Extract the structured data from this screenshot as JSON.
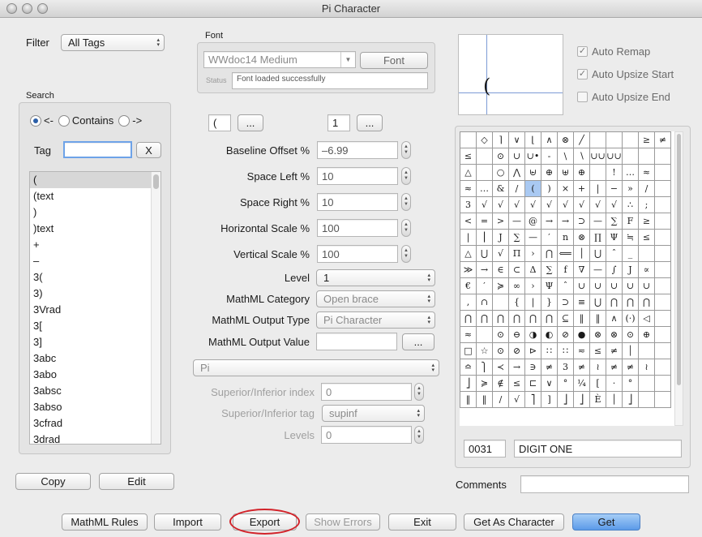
{
  "window": {
    "title": "Pi Character"
  },
  "filter": {
    "label": "Filter",
    "value": "All Tags"
  },
  "search": {
    "label": "Search",
    "dir_left": "<-",
    "contains": "Contains",
    "dir_right": "->",
    "tag_label": "Tag",
    "tag_value": "",
    "clear_label": "X",
    "items": [
      "(",
      "(text",
      ")",
      ")text",
      "+",
      "–",
      "3(",
      "3)",
      "3Vrad",
      "3[",
      "3]",
      "3abc",
      "3abo",
      "3absc",
      "3abso",
      "3cfrad",
      "3drad"
    ],
    "selected_index": 0
  },
  "left_buttons": {
    "copy": "Copy",
    "edit": "Edit"
  },
  "font": {
    "label": "Font",
    "name": "WWdoc14 Medium",
    "button": "Font",
    "status_label": "Status",
    "status_text": "Font loaded successfully"
  },
  "char_row": {
    "char_value": "(",
    "more1": "...",
    "count_value": "1",
    "more2": "..."
  },
  "params": {
    "baseline_label": "Baseline Offset %",
    "baseline_value": "–6.99",
    "space_left_label": "Space Left %",
    "space_left_value": "10",
    "space_right_label": "Space Right %",
    "space_right_value": "10",
    "hscale_label": "Horizontal Scale %",
    "hscale_value": "100",
    "vscale_label": "Vertical Scale %",
    "vscale_value": "100",
    "level_label": "Level",
    "level_value": "1",
    "mml_cat_label": "MathML Category",
    "mml_cat_value": "Open brace",
    "mml_out_type_label": "MathML Output Type",
    "mml_out_type_value": "Pi Character",
    "mml_out_value_label": "MathML Output Value",
    "mml_out_value": "",
    "mml_out_more": "...",
    "pi_value": "Pi",
    "supinf_index_label": "Superior/Inferior index",
    "supinf_index_value": "0",
    "supinf_tag_label": "Superior/Inferior tag",
    "supinf_tag_value": "supinf",
    "levels_label": "Levels",
    "levels_value": "0"
  },
  "preview": {
    "glyph": "("
  },
  "options": {
    "auto_remap": "Auto Remap",
    "auto_remap_checked": true,
    "auto_upsize_start": "Auto Upsize Start",
    "auto_upsize_start_checked": true,
    "auto_upsize_end": "Auto Upsize End",
    "auto_upsize_end_checked": false
  },
  "charmap": {
    "rows": [
      [
        "",
        "◇",
        "⌉",
        "∨",
        "⌊",
        "∧",
        "⊗",
        "╱",
        "",
        "",
        "",
        "≥",
        "≠"
      ],
      [
        "≤",
        "",
        "⊙",
        "∪",
        "∪•",
        "-",
        "\\",
        "∖",
        "∪∪",
        "∪∪",
        "",
        "",
        ""
      ],
      [
        "△",
        "",
        "○",
        "⋀",
        "⊌",
        "⊕",
        "⊎",
        "⊕",
        "",
        "!",
        "…",
        "≈",
        ""
      ],
      [
        "≈",
        "…",
        "&",
        "/",
        "(",
        ")",
        "×",
        "+",
        "|",
        "−",
        "»",
        "/",
        ""
      ],
      [
        "3",
        "√",
        "√",
        "√",
        "√",
        "√",
        "√",
        "√",
        "√",
        "√",
        "∴",
        ";",
        ""
      ],
      [
        "<",
        "=",
        ">",
        "—",
        "@",
        "→",
        "→",
        "⊃",
        "—",
        "∑",
        "F",
        "≥",
        ""
      ],
      [
        "|",
        "⎮",
        "J",
        "∑",
        "—",
        "′",
        "n",
        "⊗",
        "∏",
        "Ψ",
        "≒",
        "≤",
        ""
      ],
      [
        "△",
        "⋃",
        "√",
        "Π",
        "›",
        "⋂",
        "⟸",
        "│",
        "⋃",
        "ˆ",
        "_",
        ""
      ],
      [
        "≫",
        "→",
        "∈",
        "⊂",
        "Δ",
        "∑",
        "f",
        "∇",
        "—",
        "∫",
        "J",
        "∝"
      ],
      [
        "€",
        "′",
        "≽",
        "∞",
        "›",
        "Ψ",
        "ˆ",
        "∪",
        "∪",
        "∪",
        "∪",
        "∪"
      ],
      [
        ",",
        "∩",
        "",
        "{",
        "|",
        "}",
        "⊃",
        "≡",
        "⋃",
        "⋂",
        "⋂",
        "⋂"
      ],
      [
        "⋂",
        "⋂",
        "⋂",
        "⋂",
        "⋂",
        "⋂",
        "⊆",
        "‖",
        "‖",
        "∧",
        "(·)",
        "◁"
      ],
      [
        "≈",
        "",
        "⊙",
        "⊖",
        "◑",
        "◐",
        "⊘",
        "●",
        "⊗",
        "⊗",
        "⊙",
        "⊕"
      ],
      [
        "□",
        "☆",
        "⊙",
        "⊘",
        "⊳",
        "∷",
        "∷",
        "≂",
        "≤",
        "≠",
        "│",
        ""
      ],
      [
        "≏",
        "⎫",
        "≺",
        "→",
        "∋",
        "≠",
        "3",
        "≠",
        "≀",
        "≠",
        "≠",
        "≀"
      ],
      [
        "⎦",
        "≽",
        "∉",
        "≤",
        "⊏",
        "∨",
        "°",
        "¼",
        "[",
        "·",
        "°",
        ""
      ],
      [
        "‖",
        "‖",
        "∕",
        "√",
        "⎤",
        "]",
        "⎦",
        "⎦",
        "È",
        "│",
        "⎦",
        ""
      ]
    ],
    "highlight_row": 3,
    "highlight_col": 4,
    "code": "0031",
    "name": "DIGIT ONE"
  },
  "comments": {
    "label": "Comments",
    "value": ""
  },
  "bottom": {
    "mathml_rules": "MathML Rules",
    "import": "Import",
    "export": "Export",
    "show_errors": "Show Errors",
    "exit": "Exit",
    "get_as_character": "Get As Character",
    "get": "Get"
  }
}
